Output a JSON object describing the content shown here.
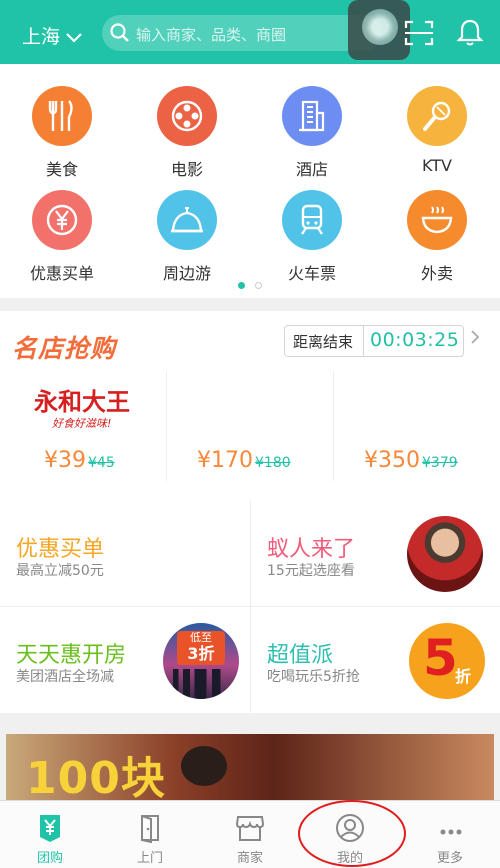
{
  "header": {
    "city": "上海",
    "search_placeholder": "输入商家、品类、商圈"
  },
  "categories": [
    {
      "label": "美食",
      "icon": "utensils-icon",
      "color": "#f57f33"
    },
    {
      "label": "电影",
      "icon": "film-reel-icon",
      "color": "#ec6245"
    },
    {
      "label": "酒店",
      "icon": "hotel-building-icon",
      "color": "#6e8df2"
    },
    {
      "label": "KTV",
      "icon": "microphone-icon",
      "color": "#f6b33e"
    },
    {
      "label": "优惠买单",
      "icon": "yen-coupon-icon",
      "color": "#f2716b"
    },
    {
      "label": "周边游",
      "icon": "tent-icon",
      "color": "#52c3e8"
    },
    {
      "label": "火车票",
      "icon": "train-icon",
      "color": "#52c3e8"
    },
    {
      "label": "外卖",
      "icon": "bowl-icon",
      "color": "#f58b2d"
    }
  ],
  "flash_sale": {
    "title": "名店抢购",
    "countdown_label": "距离结束",
    "countdown_time": "00:03:25",
    "deals": [
      {
        "logo": "永和大王",
        "slogan": "好食好滋味!",
        "price": "¥39",
        "old_price": "¥45"
      },
      {
        "price": "¥170",
        "old_price": "¥180"
      },
      {
        "price": "¥350",
        "old_price": "¥379"
      }
    ]
  },
  "promos": [
    {
      "title": "优惠买单",
      "subtitle": "最高立减50元",
      "color": "#f5a623"
    },
    {
      "title": "蚁人来了",
      "subtitle": "15元起选座看",
      "color": "#f25b7a"
    },
    {
      "title": "天天惠开房",
      "subtitle": "美团酒店全场减",
      "color": "#6abf1e",
      "badge_top": "低至",
      "badge_bottom": "3折"
    },
    {
      "title": "超值派",
      "subtitle": "吃喝玩乐5折抢",
      "color": "#2ebfb0",
      "badge_num": "5",
      "badge_unit": "折"
    }
  ],
  "banner": {
    "text": "100块"
  },
  "tabs": [
    {
      "label": "团购",
      "icon": "yen-tag-icon",
      "active": true
    },
    {
      "label": "上门",
      "icon": "door-icon"
    },
    {
      "label": "商家",
      "icon": "storefront-icon"
    },
    {
      "label": "我的",
      "icon": "user-icon"
    },
    {
      "label": "更多",
      "icon": "more-icon"
    }
  ],
  "colors": {
    "accent": "#20c3a8",
    "price": "#f5883a"
  }
}
